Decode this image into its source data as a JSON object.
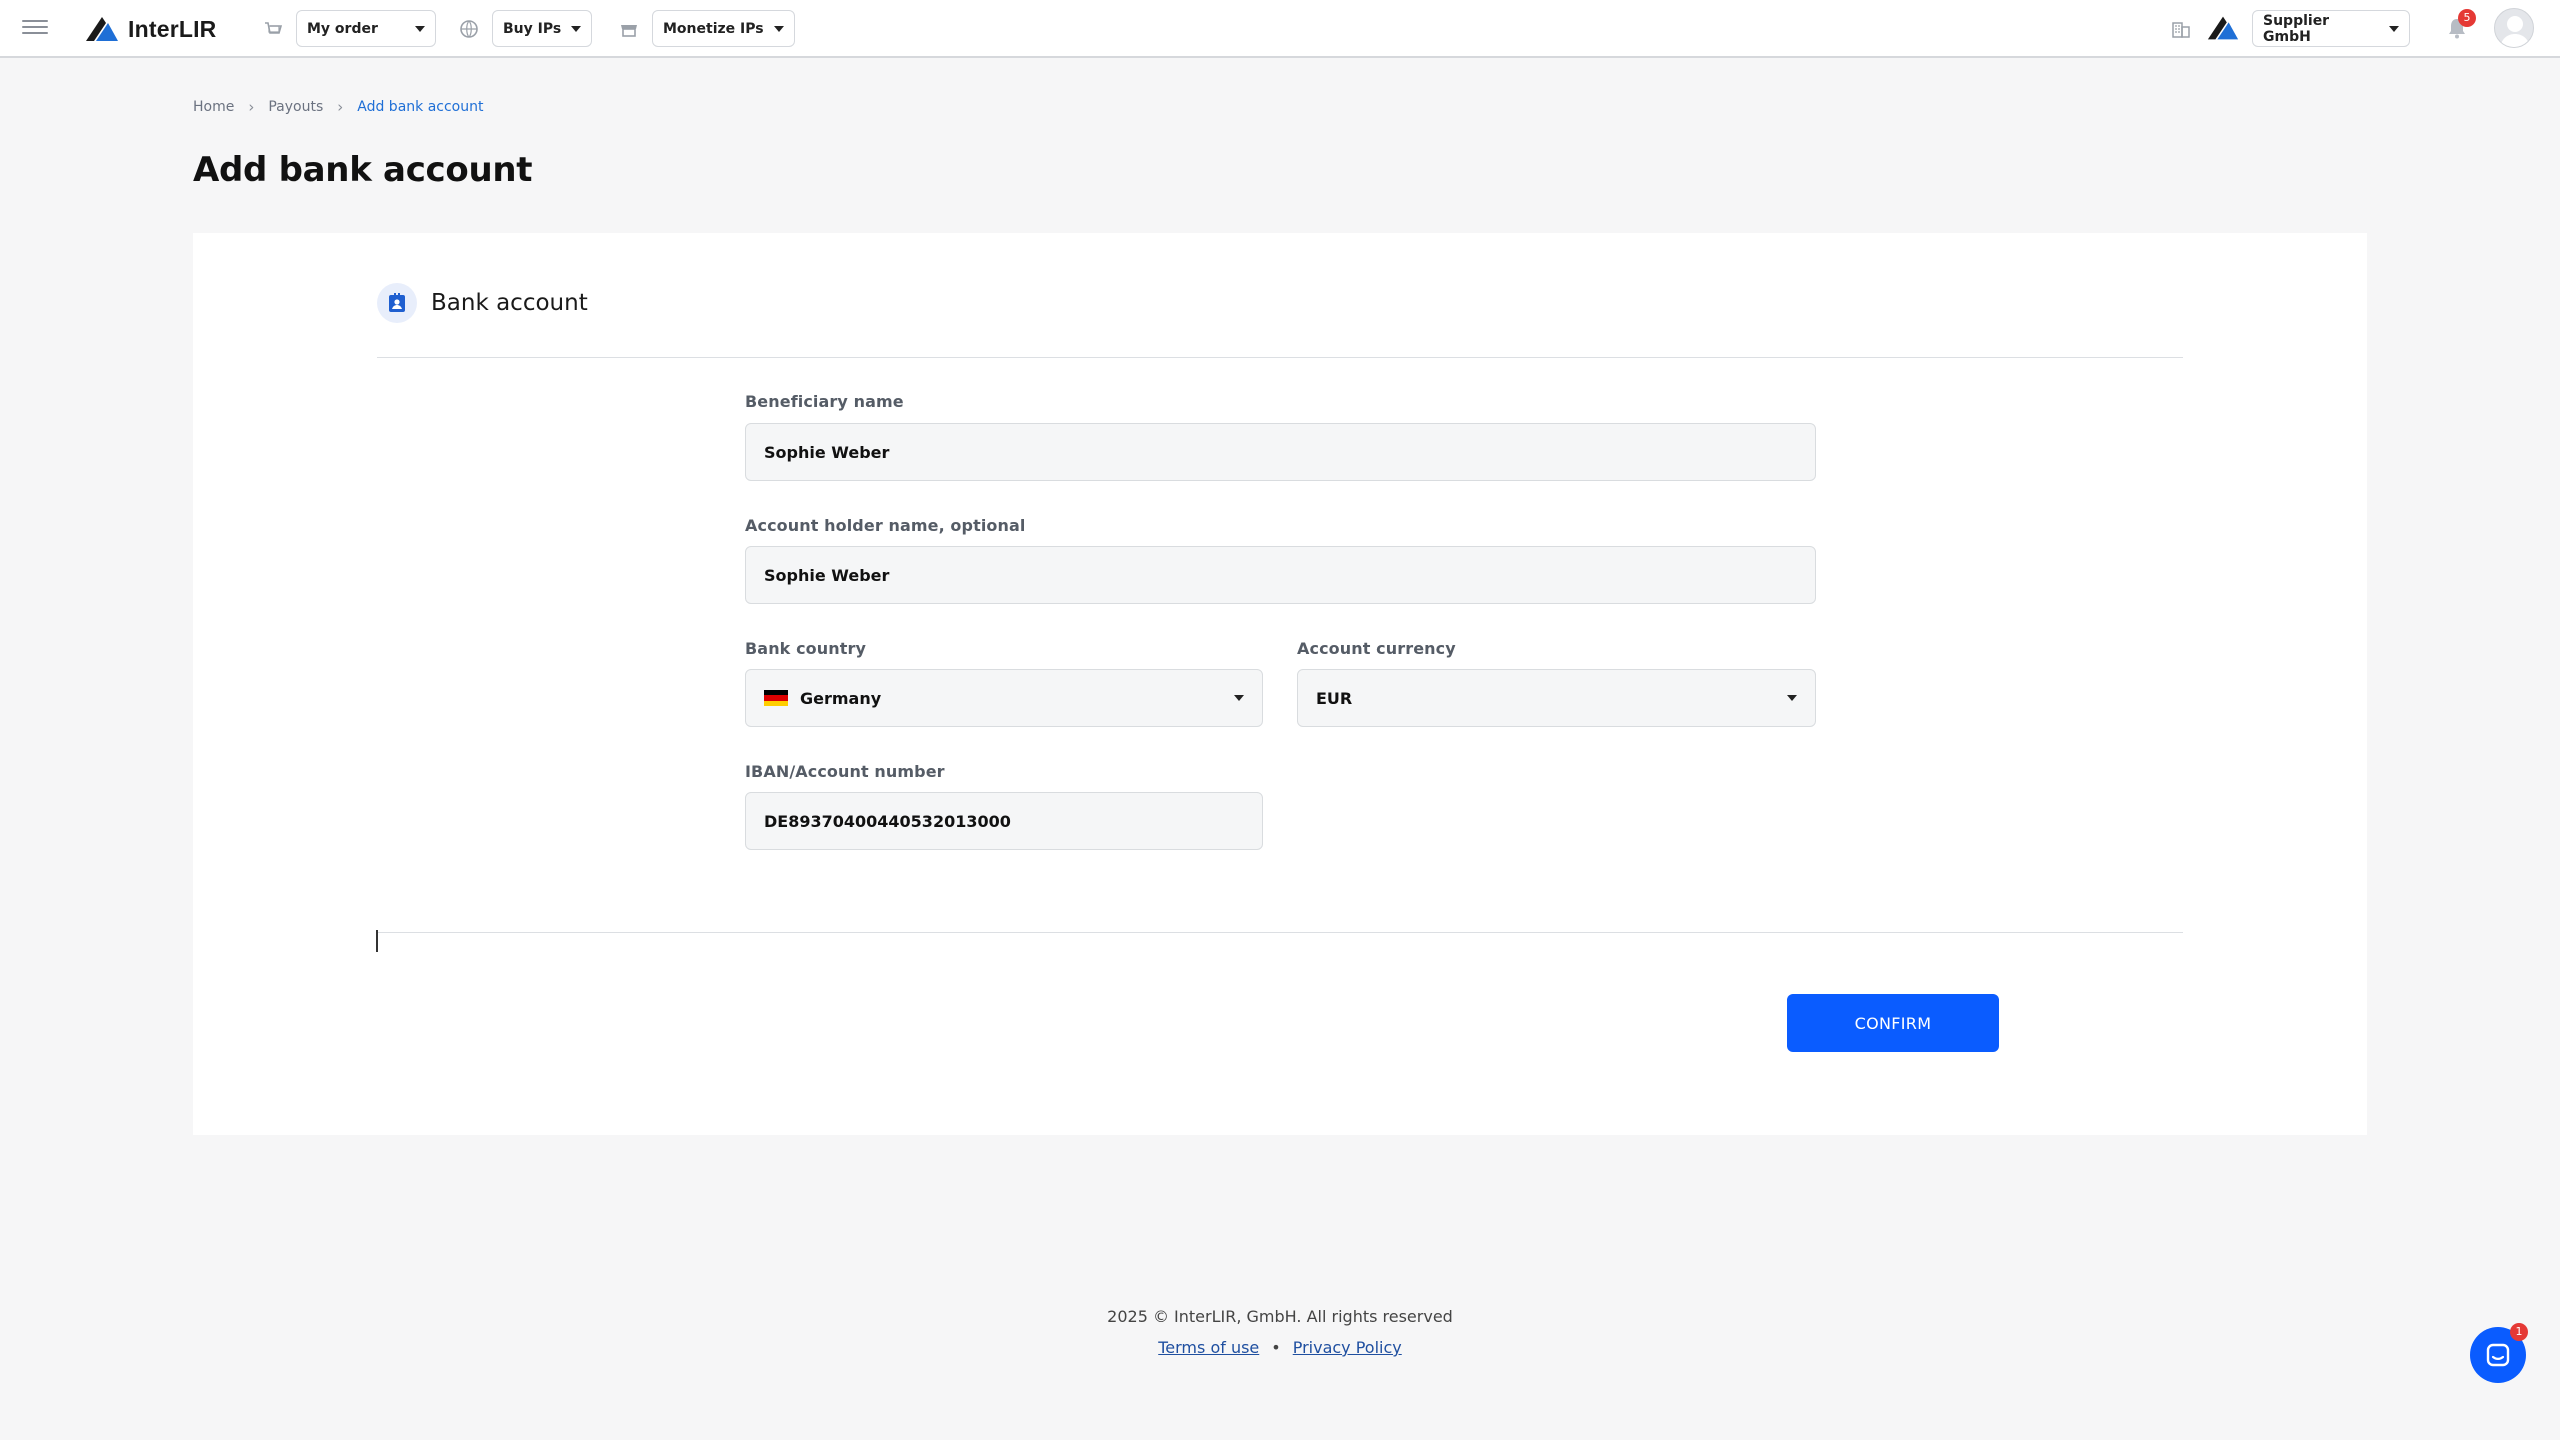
{
  "header": {
    "brand": "InterLIR",
    "nav": {
      "my_order": "My order",
      "buy_ips": "Buy IPs",
      "monetize_ips": "Monetize IPs"
    },
    "company": "Supplier GmbH",
    "notifications_count": "5"
  },
  "breadcrumb": {
    "home": "Home",
    "payouts": "Payouts",
    "current": "Add bank account"
  },
  "page": {
    "title": "Add bank account"
  },
  "form": {
    "section_title": "Bank account",
    "beneficiary_label": "Beneficiary name",
    "beneficiary_value": "Sophie Weber",
    "holder_label": "Account holder name, optional",
    "holder_value": "Sophie Weber",
    "country_label": "Bank country",
    "country_value": "Germany",
    "currency_label": "Account currency",
    "currency_value": "EUR",
    "iban_label": "IBAN/Account number",
    "iban_value": "DE89370400440532013000",
    "confirm_label": "CONFIRM"
  },
  "footer": {
    "copyright": "2025 © InterLIR, GmbH. All rights reserved",
    "terms": "Terms of use",
    "bullet": "•",
    "privacy": "Privacy Policy"
  },
  "chat": {
    "badge": "1"
  },
  "colors": {
    "accent": "#0a5cff",
    "badge": "#e53935",
    "background": "#f6f6f7"
  }
}
